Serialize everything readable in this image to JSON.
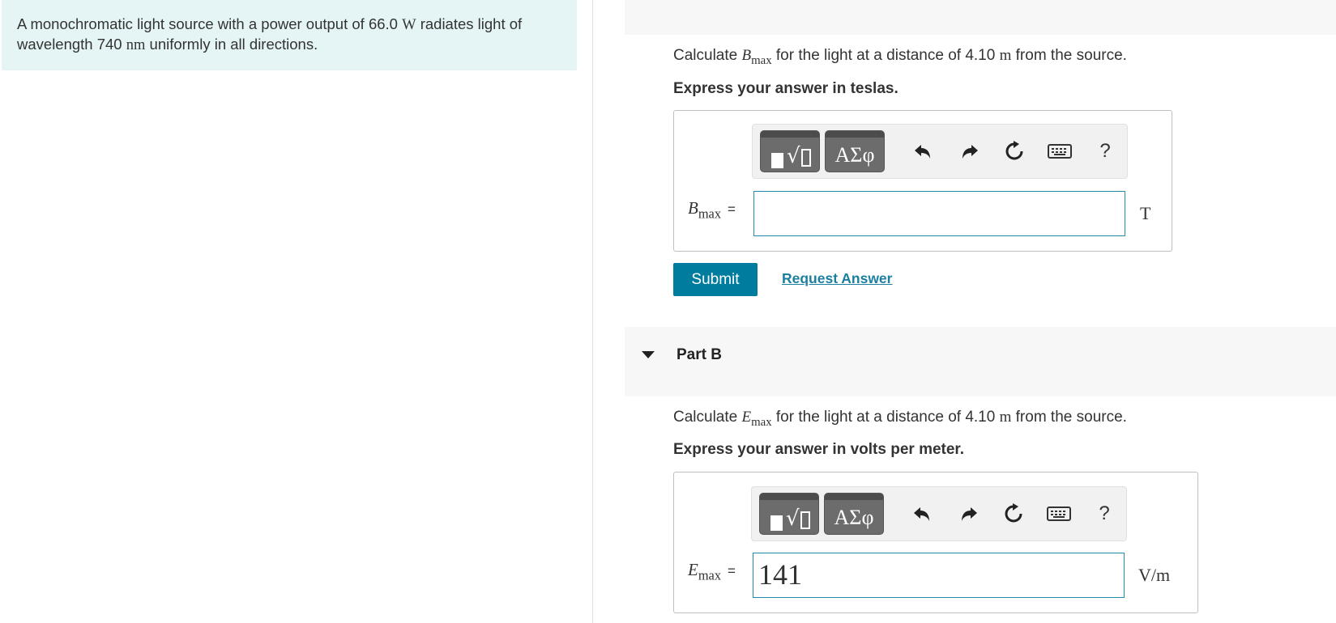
{
  "problem": {
    "t1": "A monochromatic light source with a power output of 66.0 ",
    "unit1": "W",
    "t2": " radiates light of",
    "t3": "wavelength 740 ",
    "unit2": "nm",
    "t4": " uniformly in all directions."
  },
  "part_a": {
    "q_pre": "Calculate ",
    "q_var": "B",
    "q_sub": "max",
    "q_post": " for the light at a distance of 4.10 ",
    "q_unit": "m",
    "q_end": " from the source.",
    "instruction": "Express your answer in teslas.",
    "lhs_var": "B",
    "lhs_sub": "max",
    "equals": "=",
    "input_value": "",
    "unit": "T",
    "submit_label": "Submit",
    "request_label": "Request Answer"
  },
  "part_b": {
    "title": "Part B",
    "q_pre": "Calculate ",
    "q_var": "E",
    "q_sub": "max",
    "q_post": " for the light at a distance of 4.10 ",
    "q_unit": "m",
    "q_end": " from the source.",
    "instruction": "Express your answer in volts per meter.",
    "lhs_var": "E",
    "lhs_sub": "max",
    "equals": "=",
    "input_value": "141",
    "unit": "V/m"
  },
  "toolbar": {
    "templates_icon": "templates-icon",
    "greek_label": "ΑΣφ",
    "undo_icon": "undo-icon",
    "redo_icon": "redo-icon",
    "reset_icon": "reset-icon",
    "keyboard_icon": "keyboard-icon",
    "help_label": "?"
  },
  "colors": {
    "problem_bg": "#e5f5f5",
    "accent": "#007c9f",
    "link": "#1c7fa0",
    "input_border": "#1f8fa8",
    "toolbar_button": "#6c6c6c"
  }
}
